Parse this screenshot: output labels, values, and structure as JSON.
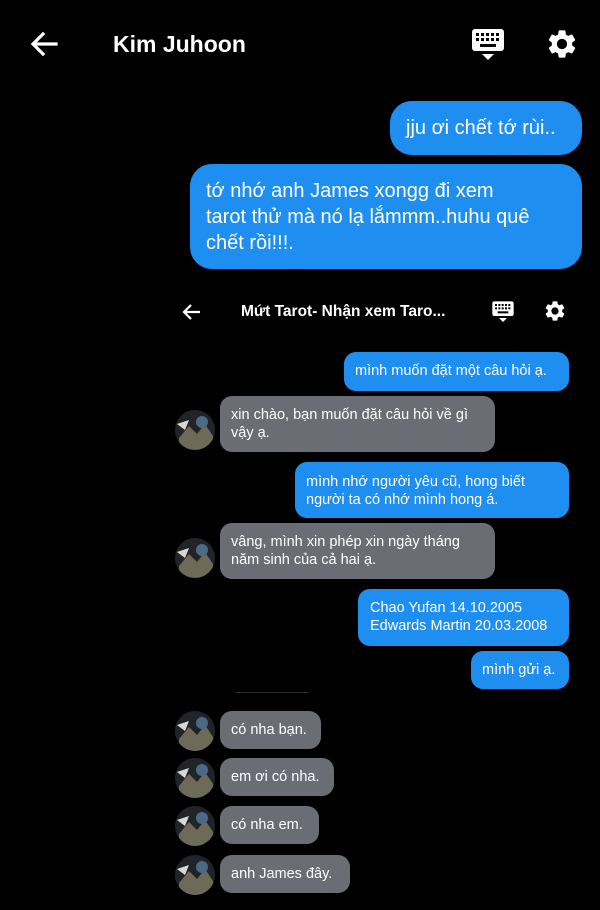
{
  "header": {
    "title": "Kim Juhoon",
    "back_icon": "arrow-left-icon",
    "keyboard_icon": "keyboard-icon",
    "settings_icon": "gear-icon"
  },
  "outer_messages": [
    {
      "text": "jju ơi chết tớ rùi..",
      "direction": "outgoing"
    },
    {
      "text_lines": [
        "tớ nhớ anh James xongg đi xem",
        "tarot thử mà nó lạ lắmmm..huhu quê",
        "chết rồi!!!."
      ],
      "direction": "outgoing"
    }
  ],
  "inner_screenshot": {
    "header": {
      "title": "Mứt Tarot- Nhận xem Taro...",
      "back_icon": "arrow-left-icon",
      "keyboard_icon": "keyboard-icon",
      "settings_icon": "gear-icon"
    },
    "messages": [
      {
        "direction": "outgoing",
        "lines": [
          "mình muốn đặt một câu hỏi ạ."
        ]
      },
      {
        "direction": "incoming",
        "lines": [
          "xin chào, bạn muốn đặt câu hỏi về gì",
          "vậy ạ."
        ]
      },
      {
        "direction": "outgoing",
        "lines": [
          "mình nhớ người yêu cũ, hong biết",
          "người ta có nhớ mình hong á."
        ]
      },
      {
        "direction": "incoming",
        "lines": [
          "vâng, mình xin phép xin ngày tháng",
          "năm sinh của cả hai ạ."
        ]
      },
      {
        "direction": "outgoing",
        "lines": [
          "Chao Yufan 14.10.2005",
          "Edwards Martin 20.03.2008"
        ]
      },
      {
        "direction": "outgoing",
        "lines": [
          "mình gửi ạ."
        ]
      },
      {
        "direction": "incoming",
        "lines": [
          "có nha bạn."
        ]
      },
      {
        "direction": "incoming",
        "lines": [
          "em ơi có nha."
        ]
      },
      {
        "direction": "incoming",
        "lines": [
          "có nha em."
        ]
      },
      {
        "direction": "incoming",
        "lines": [
          "anh James đây."
        ]
      }
    ]
  },
  "colors": {
    "background": "#000000",
    "outgoing_bubble": "#1e8ff0",
    "incoming_bubble": "#6a6d73",
    "text": "#ffffff"
  }
}
